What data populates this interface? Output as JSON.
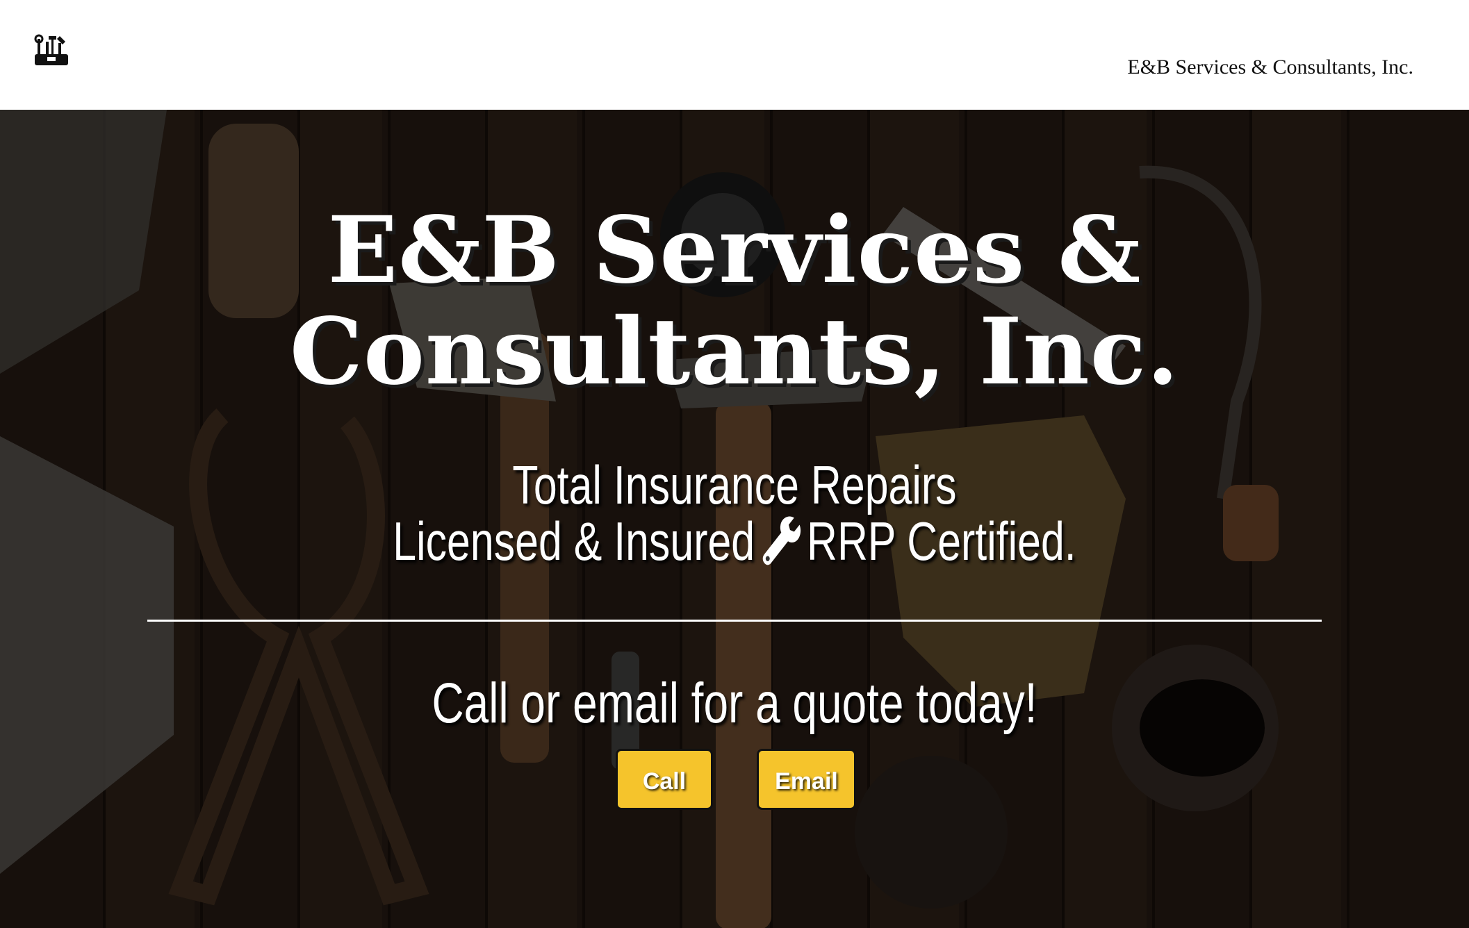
{
  "header": {
    "logo_icon": "toolbox-logo-icon",
    "brand_link": "E&B Services & Consultants, Inc."
  },
  "hero": {
    "title": "E&B Services & Consultants, Inc.",
    "tagline_line1": "Total Insurance Repairs",
    "tagline_line2_left": "Licensed & Insured",
    "tagline_icon": "wrench-icon",
    "tagline_line2_right": "RRP Certified.",
    "cta": "Call or email for a quote today!",
    "call_button": "Call",
    "email_button": "Email"
  },
  "colors": {
    "button_bg": "#f5c42c",
    "hero_overlay": "#241a14",
    "text": "#ffffff"
  }
}
